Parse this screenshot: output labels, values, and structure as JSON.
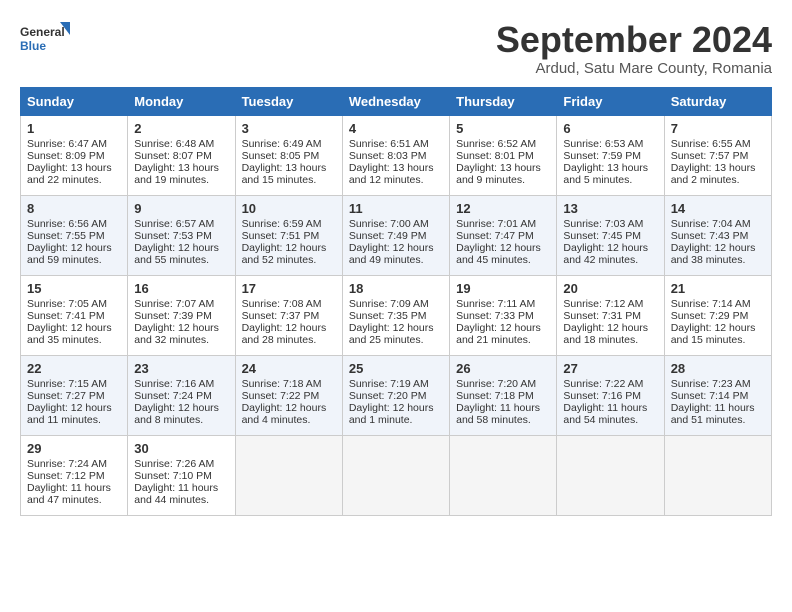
{
  "header": {
    "logo_line1": "General",
    "logo_line2": "Blue",
    "month": "September 2024",
    "location": "Ardud, Satu Mare County, Romania"
  },
  "days_of_week": [
    "Sunday",
    "Monday",
    "Tuesday",
    "Wednesday",
    "Thursday",
    "Friday",
    "Saturday"
  ],
  "weeks": [
    [
      {
        "num": "1",
        "lines": [
          "Sunrise: 6:47 AM",
          "Sunset: 8:09 PM",
          "Daylight: 13 hours",
          "and 22 minutes."
        ]
      },
      {
        "num": "2",
        "lines": [
          "Sunrise: 6:48 AM",
          "Sunset: 8:07 PM",
          "Daylight: 13 hours",
          "and 19 minutes."
        ]
      },
      {
        "num": "3",
        "lines": [
          "Sunrise: 6:49 AM",
          "Sunset: 8:05 PM",
          "Daylight: 13 hours",
          "and 15 minutes."
        ]
      },
      {
        "num": "4",
        "lines": [
          "Sunrise: 6:51 AM",
          "Sunset: 8:03 PM",
          "Daylight: 13 hours",
          "and 12 minutes."
        ]
      },
      {
        "num": "5",
        "lines": [
          "Sunrise: 6:52 AM",
          "Sunset: 8:01 PM",
          "Daylight: 13 hours",
          "and 9 minutes."
        ]
      },
      {
        "num": "6",
        "lines": [
          "Sunrise: 6:53 AM",
          "Sunset: 7:59 PM",
          "Daylight: 13 hours",
          "and 5 minutes."
        ]
      },
      {
        "num": "7",
        "lines": [
          "Sunrise: 6:55 AM",
          "Sunset: 7:57 PM",
          "Daylight: 13 hours",
          "and 2 minutes."
        ]
      }
    ],
    [
      {
        "num": "8",
        "lines": [
          "Sunrise: 6:56 AM",
          "Sunset: 7:55 PM",
          "Daylight: 12 hours",
          "and 59 minutes."
        ]
      },
      {
        "num": "9",
        "lines": [
          "Sunrise: 6:57 AM",
          "Sunset: 7:53 PM",
          "Daylight: 12 hours",
          "and 55 minutes."
        ]
      },
      {
        "num": "10",
        "lines": [
          "Sunrise: 6:59 AM",
          "Sunset: 7:51 PM",
          "Daylight: 12 hours",
          "and 52 minutes."
        ]
      },
      {
        "num": "11",
        "lines": [
          "Sunrise: 7:00 AM",
          "Sunset: 7:49 PM",
          "Daylight: 12 hours",
          "and 49 minutes."
        ]
      },
      {
        "num": "12",
        "lines": [
          "Sunrise: 7:01 AM",
          "Sunset: 7:47 PM",
          "Daylight: 12 hours",
          "and 45 minutes."
        ]
      },
      {
        "num": "13",
        "lines": [
          "Sunrise: 7:03 AM",
          "Sunset: 7:45 PM",
          "Daylight: 12 hours",
          "and 42 minutes."
        ]
      },
      {
        "num": "14",
        "lines": [
          "Sunrise: 7:04 AM",
          "Sunset: 7:43 PM",
          "Daylight: 12 hours",
          "and 38 minutes."
        ]
      }
    ],
    [
      {
        "num": "15",
        "lines": [
          "Sunrise: 7:05 AM",
          "Sunset: 7:41 PM",
          "Daylight: 12 hours",
          "and 35 minutes."
        ]
      },
      {
        "num": "16",
        "lines": [
          "Sunrise: 7:07 AM",
          "Sunset: 7:39 PM",
          "Daylight: 12 hours",
          "and 32 minutes."
        ]
      },
      {
        "num": "17",
        "lines": [
          "Sunrise: 7:08 AM",
          "Sunset: 7:37 PM",
          "Daylight: 12 hours",
          "and 28 minutes."
        ]
      },
      {
        "num": "18",
        "lines": [
          "Sunrise: 7:09 AM",
          "Sunset: 7:35 PM",
          "Daylight: 12 hours",
          "and 25 minutes."
        ]
      },
      {
        "num": "19",
        "lines": [
          "Sunrise: 7:11 AM",
          "Sunset: 7:33 PM",
          "Daylight: 12 hours",
          "and 21 minutes."
        ]
      },
      {
        "num": "20",
        "lines": [
          "Sunrise: 7:12 AM",
          "Sunset: 7:31 PM",
          "Daylight: 12 hours",
          "and 18 minutes."
        ]
      },
      {
        "num": "21",
        "lines": [
          "Sunrise: 7:14 AM",
          "Sunset: 7:29 PM",
          "Daylight: 12 hours",
          "and 15 minutes."
        ]
      }
    ],
    [
      {
        "num": "22",
        "lines": [
          "Sunrise: 7:15 AM",
          "Sunset: 7:27 PM",
          "Daylight: 12 hours",
          "and 11 minutes."
        ]
      },
      {
        "num": "23",
        "lines": [
          "Sunrise: 7:16 AM",
          "Sunset: 7:24 PM",
          "Daylight: 12 hours",
          "and 8 minutes."
        ]
      },
      {
        "num": "24",
        "lines": [
          "Sunrise: 7:18 AM",
          "Sunset: 7:22 PM",
          "Daylight: 12 hours",
          "and 4 minutes."
        ]
      },
      {
        "num": "25",
        "lines": [
          "Sunrise: 7:19 AM",
          "Sunset: 7:20 PM",
          "Daylight: 12 hours",
          "and 1 minute."
        ]
      },
      {
        "num": "26",
        "lines": [
          "Sunrise: 7:20 AM",
          "Sunset: 7:18 PM",
          "Daylight: 11 hours",
          "and 58 minutes."
        ]
      },
      {
        "num": "27",
        "lines": [
          "Sunrise: 7:22 AM",
          "Sunset: 7:16 PM",
          "Daylight: 11 hours",
          "and 54 minutes."
        ]
      },
      {
        "num": "28",
        "lines": [
          "Sunrise: 7:23 AM",
          "Sunset: 7:14 PM",
          "Daylight: 11 hours",
          "and 51 minutes."
        ]
      }
    ],
    [
      {
        "num": "29",
        "lines": [
          "Sunrise: 7:24 AM",
          "Sunset: 7:12 PM",
          "Daylight: 11 hours",
          "and 47 minutes."
        ]
      },
      {
        "num": "30",
        "lines": [
          "Sunrise: 7:26 AM",
          "Sunset: 7:10 PM",
          "Daylight: 11 hours",
          "and 44 minutes."
        ]
      },
      null,
      null,
      null,
      null,
      null
    ]
  ]
}
